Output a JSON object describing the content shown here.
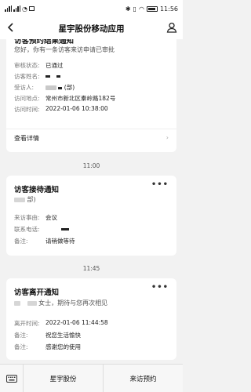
{
  "status_bar": {
    "time": "11:56",
    "battery": "100"
  },
  "header": {
    "title": "星宇股份移动应用"
  },
  "card1": {
    "title": "访客预约结果通知",
    "greeting": "您好，你有一条访客来访申请已审批",
    "rows": [
      {
        "label": "审核状态:",
        "value": "已通过"
      },
      {
        "label": "访客姓名:",
        "value": ""
      },
      {
        "label": "受访人:",
        "value": "(部)"
      },
      {
        "label": "访问地点:",
        "value": "常州市新北区秦岭路182号"
      },
      {
        "label": "访问时间:",
        "value": "2022-01-06 10:38:00"
      }
    ],
    "detail_label": "查看详情"
  },
  "time_divider_1": "11:00",
  "card2": {
    "title": "访客接待通知",
    "dept": "部)",
    "rows": [
      {
        "label": "来访事由:",
        "value": "会议"
      },
      {
        "label": "联系电话:",
        "value": ""
      },
      {
        "label": "备注:",
        "value": "请稍做等待"
      }
    ]
  },
  "time_divider_2": "11:45",
  "card3": {
    "title": "访客离开通知",
    "greeting": "女士，期待与您再次相见",
    "rows": [
      {
        "label": "离开时间:",
        "value": "2022-01-06 11:44:58"
      },
      {
        "label": "备注:",
        "value": "祝您生活愉快"
      },
      {
        "label": "备注:",
        "value": "感谢您的使用"
      }
    ]
  },
  "bottom_menu": {
    "item1": "星宇股份",
    "item2": "来访预约"
  }
}
